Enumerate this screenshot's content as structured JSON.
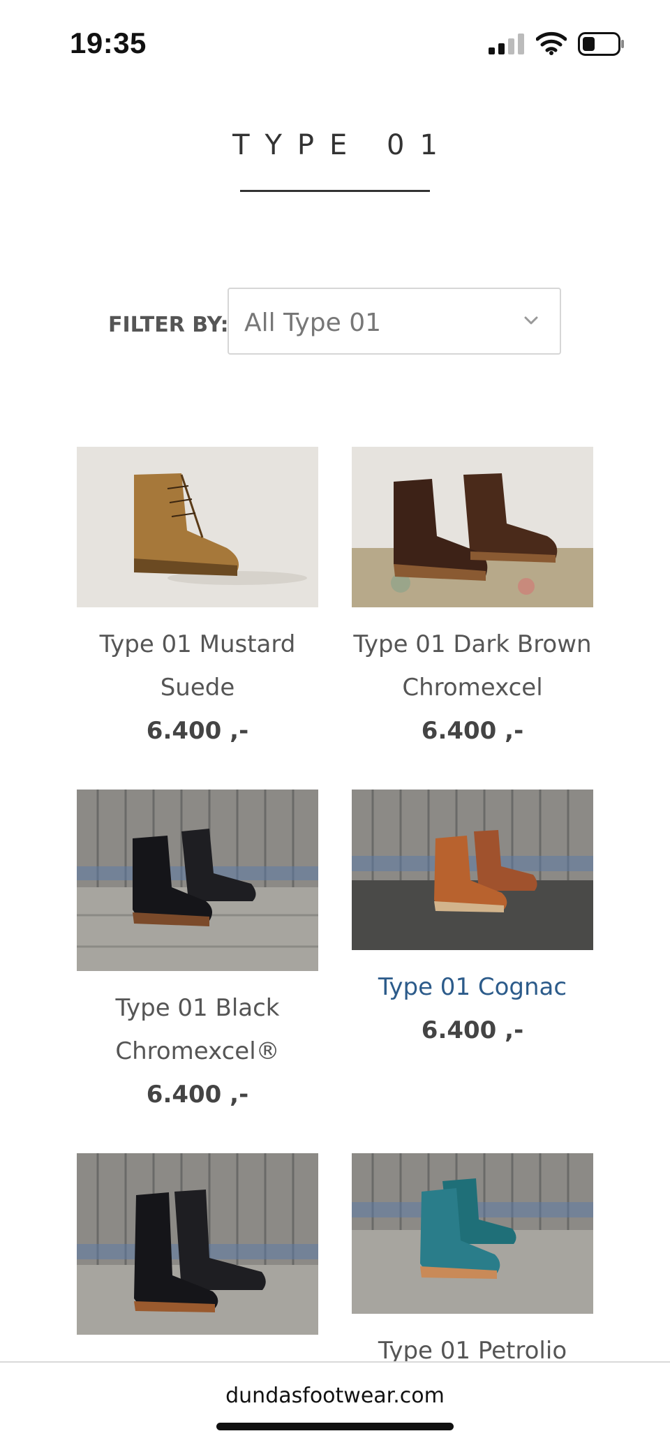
{
  "status_bar": {
    "time": "19:35",
    "icons": [
      "signal-icon",
      "wifi-icon",
      "battery-icon"
    ]
  },
  "page": {
    "title": "TYPE 01"
  },
  "filter": {
    "label": "FILTER BY:",
    "selected": "All Type 01"
  },
  "products": [
    {
      "name": "Type 01 Mustard Suede",
      "price": "6.400 ,-",
      "image": "boot-mustard-suede"
    },
    {
      "name": "Type 01 Dark Brown Chromexcel",
      "price": "6.400 ,-",
      "image": "boot-dark-brown"
    },
    {
      "name": "Type 01 Black Chromexcel®",
      "price": "6.400 ,-",
      "image": "boot-black"
    },
    {
      "name": "Type 01 Cognac",
      "price": "6.400 ,-",
      "image": "boot-cognac"
    },
    {
      "name": "",
      "price": "",
      "image": "boot-black-tall"
    },
    {
      "name": "Type 01 Petrolio",
      "price": "",
      "image": "boot-petrolio"
    }
  ],
  "browser": {
    "domain": "dundasfootwear.com"
  },
  "colors": {
    "link": "#2c5b8a",
    "text": "#444444"
  }
}
